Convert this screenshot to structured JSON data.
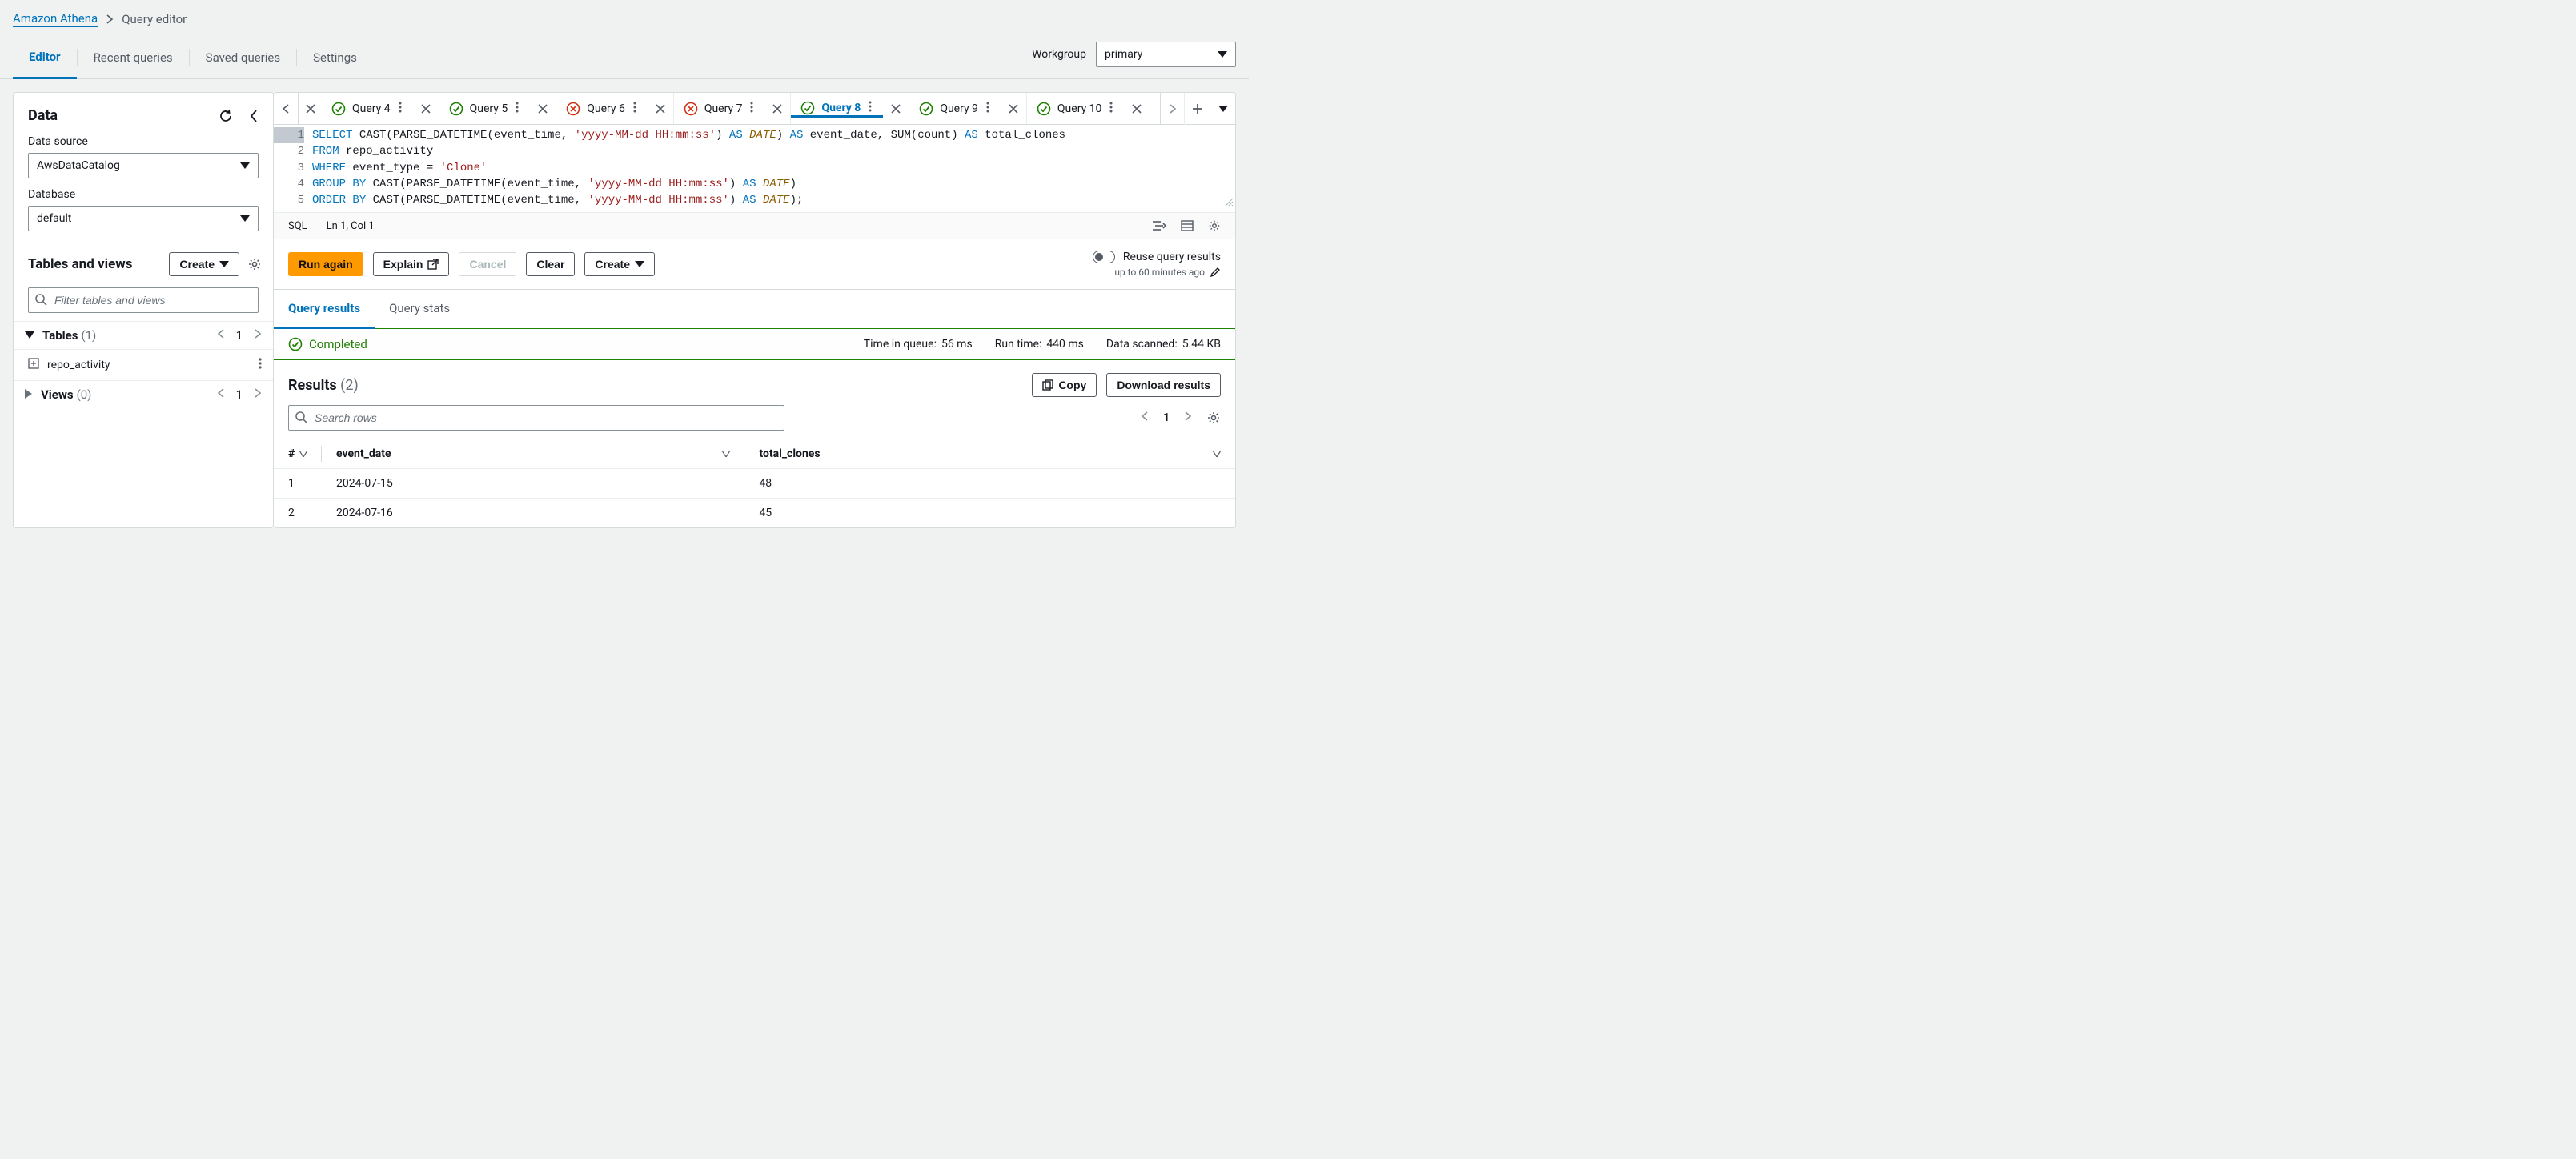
{
  "breadcrumb": {
    "service": "Amazon Athena",
    "page": "Query editor"
  },
  "main_tabs": {
    "editor": "Editor",
    "recent": "Recent queries",
    "saved": "Saved queries",
    "settings": "Settings"
  },
  "workgroup": {
    "label": "Workgroup",
    "value": "primary"
  },
  "sidebar": {
    "title": "Data",
    "data_source": {
      "label": "Data source",
      "value": "AwsDataCatalog"
    },
    "database": {
      "label": "Database",
      "value": "default"
    },
    "tv_title": "Tables and views",
    "create_label": "Create",
    "filter_placeholder": "Filter tables and views",
    "tables_header": "Tables",
    "tables_count": "(1)",
    "tables_page": "1",
    "table_items": [
      {
        "name": "repo_activity"
      }
    ],
    "views_header": "Views",
    "views_count": "(0)",
    "views_page": "1"
  },
  "query_tabs": [
    {
      "label": "Query 4",
      "state": "ok"
    },
    {
      "label": "Query 5",
      "state": "ok"
    },
    {
      "label": "Query 6",
      "state": "err"
    },
    {
      "label": "Query 7",
      "state": "err"
    },
    {
      "label": "Query 8",
      "state": "ok",
      "active": true
    },
    {
      "label": "Query 9",
      "state": "ok"
    },
    {
      "label": "Query 10",
      "state": "ok"
    }
  ],
  "editor": {
    "lines": {
      "l1a": "SELECT",
      "l1b": " CAST(PARSE_DATETIME(event_time, ",
      "l1c": "'yyyy-MM-dd HH:mm:ss'",
      "l1d": ") ",
      "l1as": "AS",
      "l1dt": " DATE",
      "l1e": ") ",
      "l1as2": "AS",
      "l1f": " event_date, SUM(count) ",
      "l1as3": "AS",
      "l1g": " total_clones",
      "l2a": "FROM",
      "l2b": " repo_activity",
      "l3a": "WHERE",
      "l3b": " event_type = ",
      "l3c": "'Clone'",
      "l4a": "GROUP",
      "l4by": " BY",
      "l4b": " CAST(PARSE_DATETIME(event_time, ",
      "l4c": "'yyyy-MM-dd HH:mm:ss'",
      "l4d": ") ",
      "l4as": "AS",
      "l4dt": " DATE",
      "l4e": ")",
      "l5a": "ORDER",
      "l5by": " BY",
      "l5b": " CAST(PARSE_DATETIME(event_time, ",
      "l5c": "'yyyy-MM-dd HH:mm:ss'",
      "l5d": ") ",
      "l5as": "AS",
      "l5dt": " DATE",
      "l5e": ");"
    },
    "lang": "SQL",
    "caret": "Ln 1, Col 1"
  },
  "actions": {
    "run": "Run again",
    "explain": "Explain",
    "cancel": "Cancel",
    "clear": "Clear",
    "create": "Create",
    "reuse": "Reuse query results",
    "reuse_hint": "up to 60 minutes ago"
  },
  "result_tabs": {
    "results": "Query results",
    "stats": "Query stats"
  },
  "status": {
    "label": "Completed",
    "queue_k": "Time in queue:",
    "queue_v": "56 ms",
    "run_k": "Run time:",
    "run_v": "440 ms",
    "scan_k": "Data scanned:",
    "scan_v": "5.44 KB"
  },
  "results": {
    "title": "Results",
    "count": "(2)",
    "copy": "Copy",
    "download": "Download results",
    "search_placeholder": "Search rows",
    "page": "1",
    "columns": {
      "c0": "#",
      "c1": "event_date",
      "c2": "total_clones"
    },
    "rows": [
      {
        "n": "1",
        "event_date": "2024-07-15",
        "total_clones": "48"
      },
      {
        "n": "2",
        "event_date": "2024-07-16",
        "total_clones": "45"
      }
    ]
  }
}
